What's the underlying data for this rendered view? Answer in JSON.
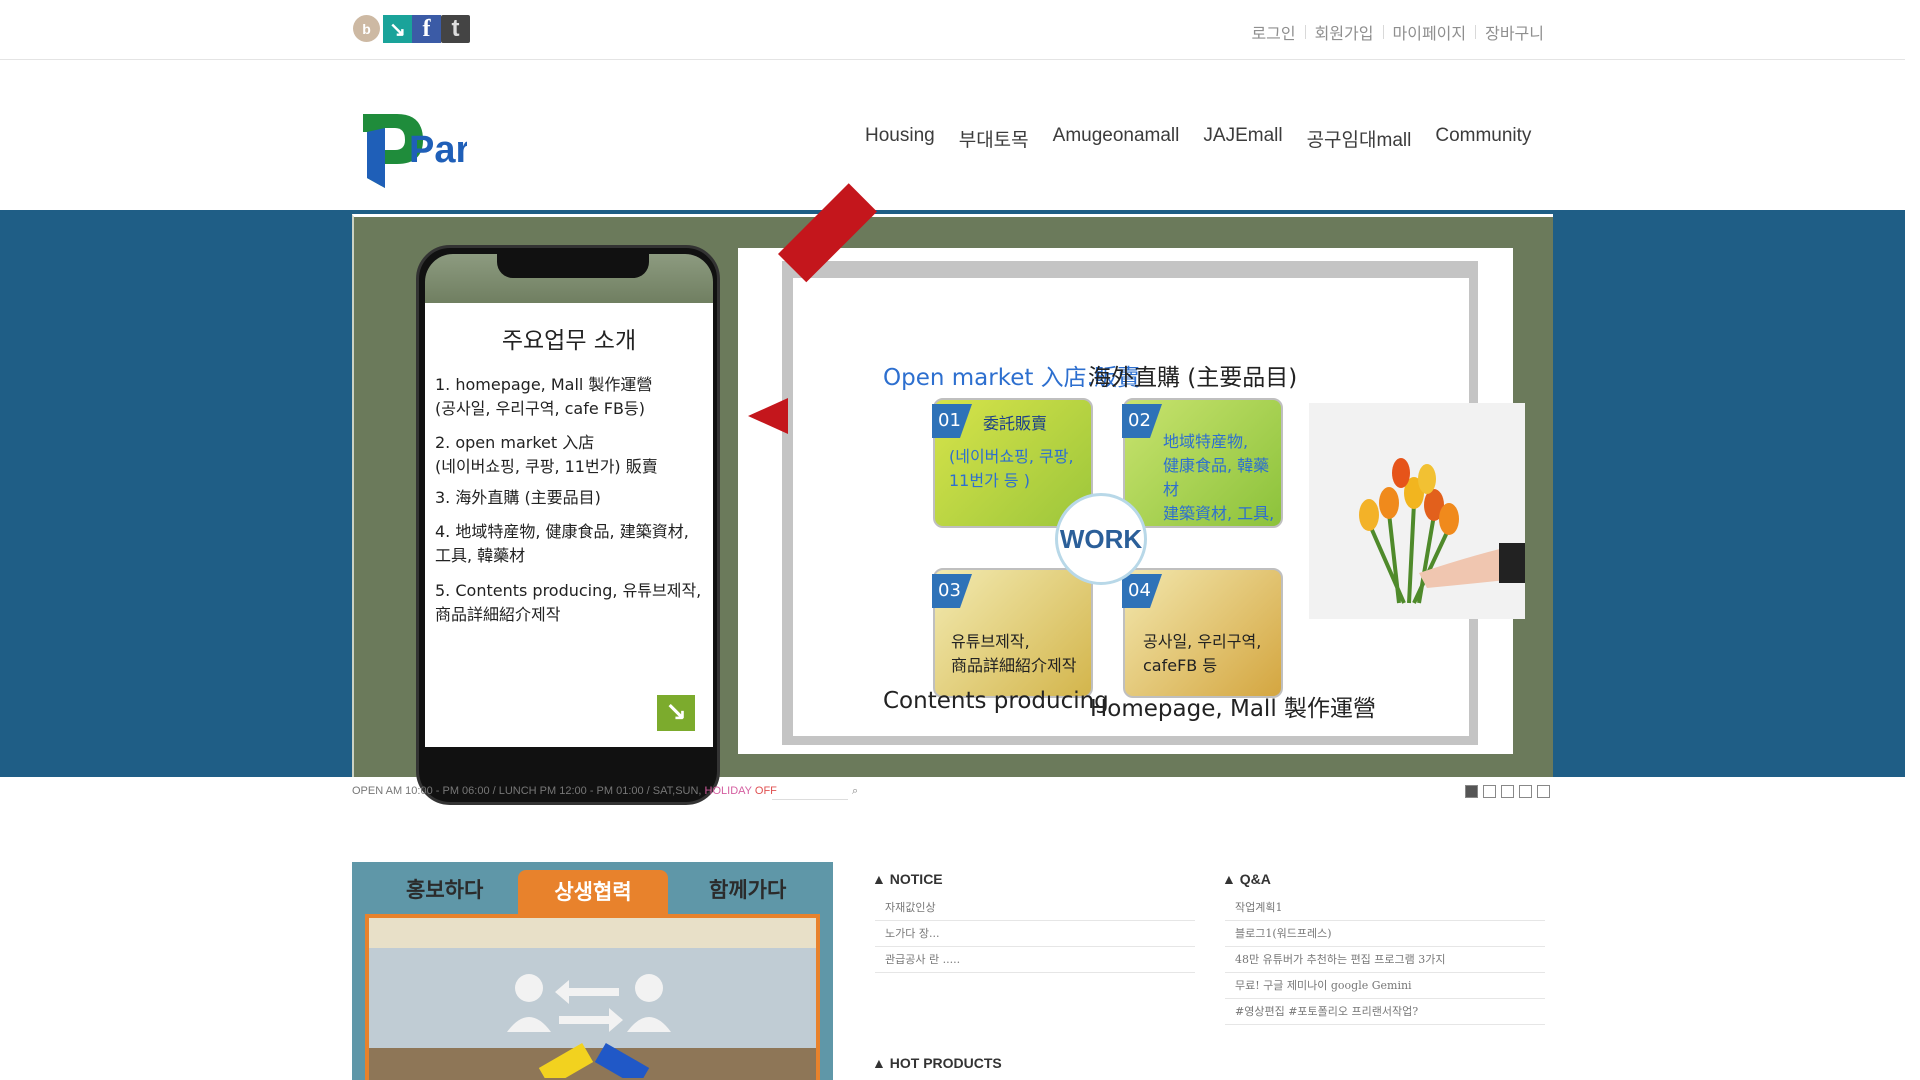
{
  "top_links": [
    "로그인",
    "회원가입",
    "마이페이지",
    "장바구니"
  ],
  "social_icons": [
    "blog-icon",
    "arrow-icon",
    "facebook-icon",
    "twitter-icon"
  ],
  "social_glyphs": {
    "blog": "b",
    "arrow": "↘",
    "facebook": "f",
    "twitter": "t"
  },
  "logo_text": "Par",
  "nav": [
    "Housing",
    "부대토목",
    "Amugeonamall",
    "JAJEmall",
    "공구임대mall",
    "Community"
  ],
  "hero": {
    "phone": {
      "title": "주요업무 소개",
      "items": [
        "1. homepage, Mall 製作運營\n(공사일, 우리구역, cafe FB등)",
        "2. open market 入店\n (네이버쇼핑, 쿠팡, 11번가) 販賣",
        "3. 海外直購  (主要品目)",
        "4. 地域特産物, 健康食品, 建築資材,\n   工具, 韓藥材",
        "5. Contents producing, 유튜브제작,\n   商品詳細紹介제작"
      ],
      "arrow": "↘"
    },
    "slide": {
      "open_market": "Open market 入店.販賣",
      "overseas": "海外直購 (主要品目)",
      "contents": "Contents producing",
      "homepage": "Homepage, Mall 製作運營",
      "center": "WORK",
      "quads": [
        {
          "num": "01",
          "title": "委託販賣",
          "text": "(네이버쇼핑, 쿠팡,\n11번가 등 )"
        },
        {
          "num": "02",
          "text": "地域特産物,\n健康食品, 韓藥材\n建築資材, 工具,"
        },
        {
          "num": "03",
          "text": "유튜브제작,\n商品詳細紹介제작"
        },
        {
          "num": "04",
          "text": "공사일, 우리구역,\ncafeFB 등"
        }
      ]
    }
  },
  "infobar": {
    "hours": "OPEN AM 10:00 - PM 06:00  /  LUNCH PM 12:00 - PM 01:00  /  SAT,SUN, ",
    "holiday": "HOLIDAY",
    "off": " OFF",
    "search_icon": "⌕",
    "slide_count": 5,
    "active_slide": 1
  },
  "promo": {
    "tabs": [
      "홍보하다",
      "상생협력",
      "함께가다"
    ],
    "active_tab": "상생협력"
  },
  "notice": {
    "title": "▲ NOTICE",
    "items": [
      "자재값인상",
      "노가다 장...",
      "관급공사 란 ....."
    ]
  },
  "qna": {
    "title": "▲ Q&A",
    "items": [
      "작업계획1",
      "블로그1(워드프레스)",
      "48만 유튜버가 추천하는 편집 프로그램 3가지",
      "무료! 구글 제미나이 google Gemini",
      "#영상편집 #포토폴리오 프리랜서작업?"
    ]
  },
  "hot_products": {
    "title": "▲ HOT PRODUCTS"
  }
}
